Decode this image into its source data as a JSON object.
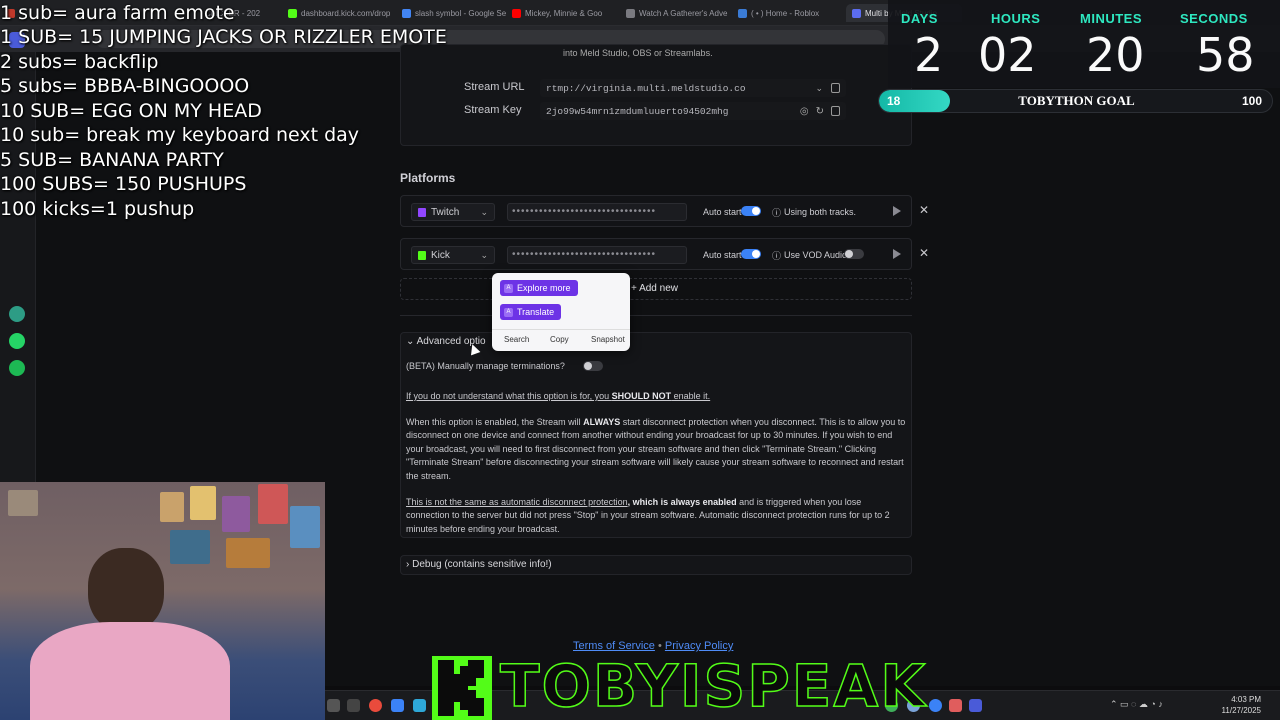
{
  "browser": {
    "tabs": [
      {
        "label": "CLICKER - 202",
        "icon": "circle-icon"
      },
      {
        "label": "dashboard.kick.com/drop",
        "icon": "kick-icon"
      },
      {
        "label": "slash symbol - Google Se",
        "icon": "google-icon"
      },
      {
        "label": "Mickey, Minnie & Goo",
        "icon": "youtube-icon"
      },
      {
        "label": "Watch A Gatherer's Adve",
        "icon": "circle-icon"
      },
      {
        "label": "( • ) Home - Roblox",
        "icon": "roblox-icon"
      },
      {
        "label": "Multi by Meld Studio",
        "icon": "meld-icon"
      }
    ]
  },
  "stream": {
    "intro_text": "into Meld Studio, OBS or Streamlabs.",
    "url_label": "Stream URL",
    "url_value": "rtmp://virginia.multi.meldstudio.co",
    "key_label": "Stream Key",
    "key_value": "2jo99w54mrn1zmdumluuerto94502mhg"
  },
  "platforms": {
    "heading": "Platforms",
    "rows": [
      {
        "name": "Twitch",
        "dots": "••••••••••••••••••••••••••••••••",
        "auto_start": "Auto start",
        "option": "Using both tracks."
      },
      {
        "name": "Kick",
        "dots": "••••••••••••••••••••••••••••••••",
        "auto_start": "Auto start",
        "option": "Use VOD Audio"
      }
    ],
    "add_new": "Add new"
  },
  "context_menu": {
    "explore": "Explore more",
    "translate": "Translate",
    "search": "Search",
    "copy": "Copy",
    "snapshot": "Snapshot"
  },
  "advanced": {
    "header": "Advanced optio",
    "toggle_label": "(BETA) Manually manage terminations?",
    "warning_start": "If you do not understand what this option is for, you ",
    "warning_bold": "SHOULD NOT",
    "warning_end": " enable it.",
    "p1_a": "When this option is enabled, the Stream will ",
    "p1_bold": "ALWAYS",
    "p1_b": " start disconnect protection when you disconnect. This is to allow you to disconnect on one device and connect from another without ending your broadcast for up to 30 minutes. If you wish to end your broadcast, you will need to first disconnect from your stream software and then click \"Terminate Stream.\" Clicking \"Terminate Stream\" before disconnecting your stream software will likely cause your stream software to reconnect and restart the stream.",
    "p2_underline": "This is not the same as automatic disconnect protection",
    "p2_bold": ", which is always enabled",
    "p2_rest": " and is triggered when you lose connection to the server but did not press \"Stop\" in your stream software. Automatic disconnect protection runs for up to 2 minutes before ending your broadcast."
  },
  "debug": {
    "label": "Debug (contains sensitive info!)"
  },
  "footer": {
    "terms": "Terms of Service",
    "separator": "•",
    "privacy": "Privacy Policy"
  },
  "overlay_goals": [
    "1 sub= aura farm emote",
    "1 SUB= 15 JUMPING JACKS OR RIZZLER EMOTE",
    "2 subs= backflip",
    "5 subs= BBBA-BINGOOOO",
    "10 SUB= EGG ON MY HEAD",
    "10 sub= break my keyboard next day",
    "5 SUB= BANANA  PARTY",
    "100 SUBS= 150 PUSHUPS",
    "100 kicks=1 pushup"
  ],
  "timer": {
    "labels": [
      "DAYS",
      "HOURS",
      "MINUTES",
      "SECONDS"
    ],
    "values": [
      "2",
      "02",
      "20",
      "58"
    ]
  },
  "goal_bar": {
    "current": "18",
    "title": "TOBYTHON GOAL",
    "target": "100",
    "fraction": 0.18
  },
  "watermark": {
    "text": "TOBYISPEAK"
  },
  "clock": {
    "time": "4:03 PM",
    "date": "11/27/2025"
  },
  "colors": {
    "accent": "#3b82f6",
    "kick_green": "#53fc18",
    "teal": "#2ee8c0",
    "purple": "#6d33e6"
  }
}
